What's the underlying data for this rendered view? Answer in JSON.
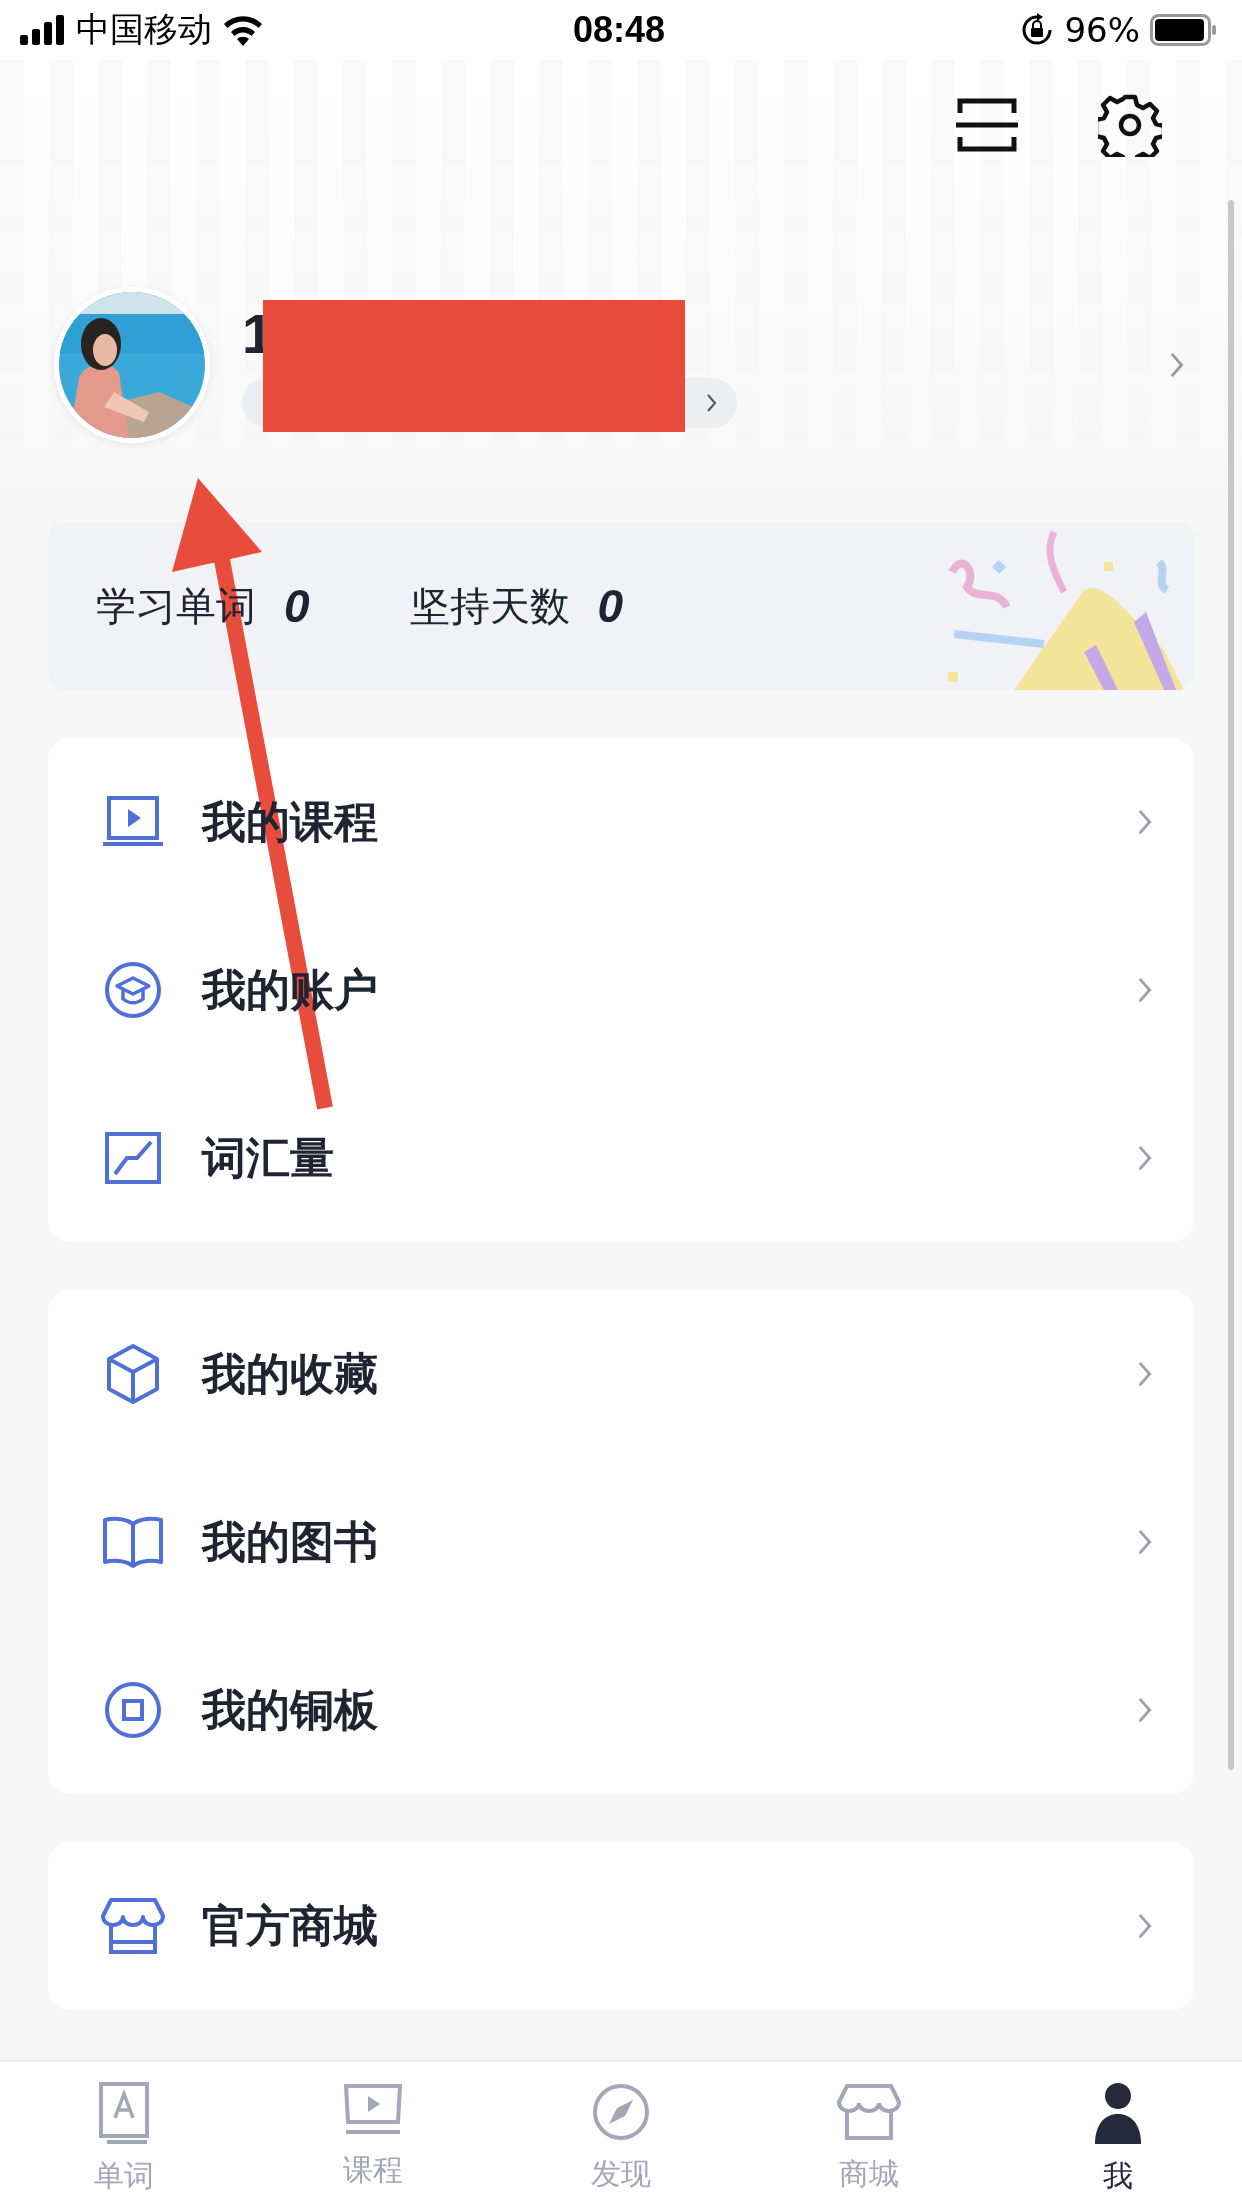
{
  "status_bar": {
    "carrier": "中国移动",
    "time": "08:48",
    "battery_percent": "96%"
  },
  "profile": {
    "name": "1"
  },
  "stats": [
    {
      "label": "学习单词",
      "value": "0"
    },
    {
      "label": "坚持天数",
      "value": "0"
    }
  ],
  "menu_groups": [
    [
      {
        "kind": "course",
        "label": "我的课程"
      },
      {
        "kind": "account",
        "label": "我的账户"
      },
      {
        "kind": "vocab",
        "label": "词汇量"
      }
    ],
    [
      {
        "kind": "favorites",
        "label": "我的收藏"
      },
      {
        "kind": "books",
        "label": "我的图书"
      },
      {
        "kind": "coins",
        "label": "我的铜板"
      }
    ],
    [
      {
        "kind": "store",
        "label": "官方商城"
      }
    ]
  ],
  "tab_bar": [
    {
      "kind": "words",
      "label": "单词",
      "selected": false
    },
    {
      "kind": "course",
      "label": "课程",
      "selected": false
    },
    {
      "kind": "discover",
      "label": "发现",
      "selected": false
    },
    {
      "kind": "store",
      "label": "商城",
      "selected": false
    },
    {
      "kind": "me",
      "label": "我",
      "selected": true
    }
  ],
  "annotations": {
    "redaction_box": true,
    "arrow": true
  }
}
